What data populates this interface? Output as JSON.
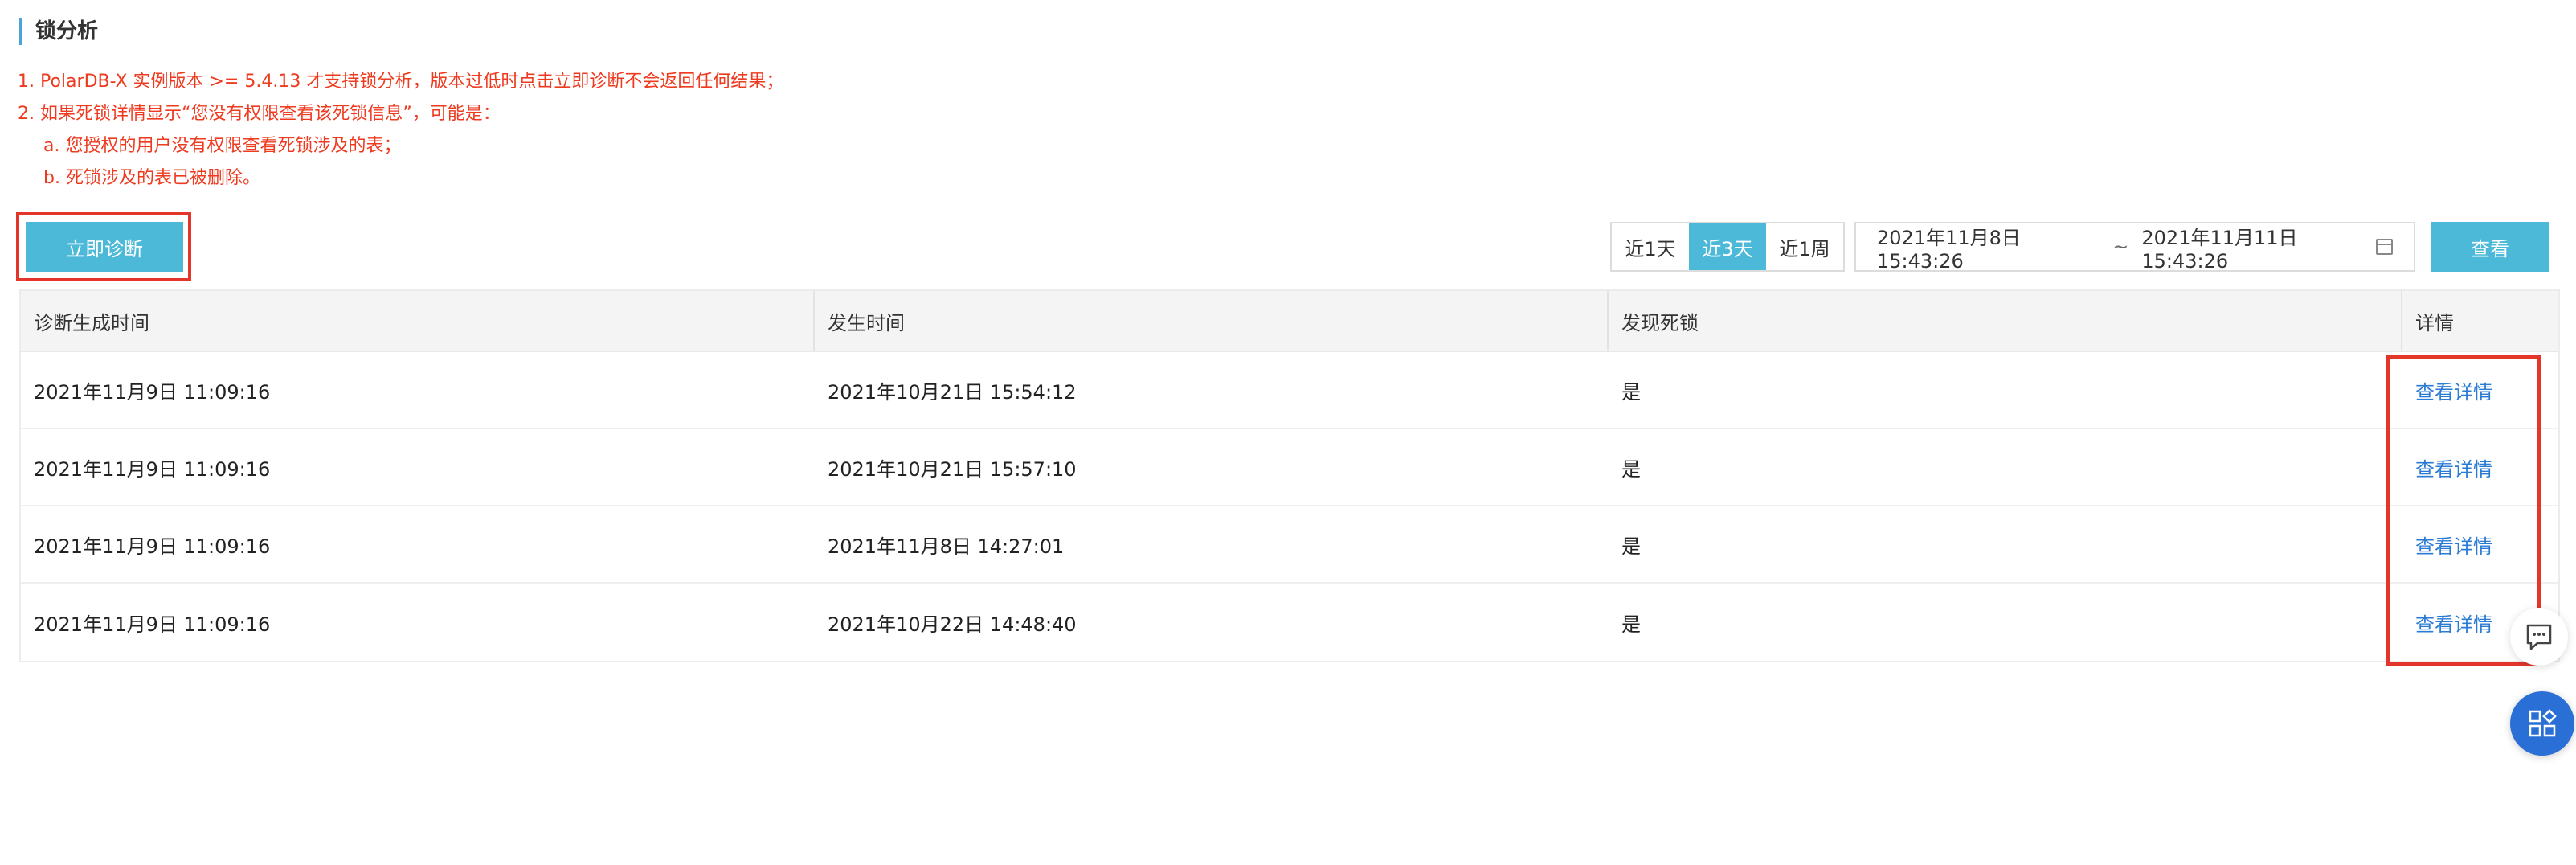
{
  "section": {
    "title": "锁分析"
  },
  "notes": [
    "1. PolarDB-X 实例版本 >= 5.4.13 才支持锁分析，版本过低时点击立即诊断不会返回任何结果；",
    "2. 如果死锁详情显示“您没有权限查看该死锁信息”，可能是：",
    "a. 您授权的用户没有权限查看死锁涉及的表；",
    "b. 死锁涉及的表已被删除。"
  ],
  "toolbar": {
    "diagnose_label": "立即诊断",
    "ranges": [
      "近1天",
      "近3天",
      "近1周"
    ],
    "active_range": "近3天",
    "date_start": "2021年11月8日 15:43:26",
    "date_sep": "~",
    "date_end": "2021年11月11日 15:43:26",
    "query_label": "查看"
  },
  "table": {
    "headers": [
      "诊断生成时间",
      "发生时间",
      "发现死锁",
      "详情"
    ],
    "rows": [
      [
        "2021年11月9日 11:09:16",
        "2021年10月21日 15:54:12",
        "是",
        "查看详情"
      ],
      [
        "2021年11月9日 11:09:16",
        "2021年10月21日 15:57:10",
        "是",
        "查看详情"
      ],
      [
        "2021年11月9日 11:09:16",
        "2021年11月8日 14:27:01",
        "是",
        "查看详情"
      ],
      [
        "2021年11月9日 11:09:16",
        "2021年10月22日 14:48:40",
        "是",
        "查看详情"
      ]
    ]
  },
  "icons": {
    "calendar": "calendar-icon",
    "chat": "chat-icon",
    "apps": "apps-icon"
  },
  "colors": {
    "accent": "#4cb9d8",
    "warning_text": "#ee3a1f",
    "link": "#2a7bd4",
    "highlight_box": "#e4352b",
    "float_button": "#2a6fd6"
  }
}
